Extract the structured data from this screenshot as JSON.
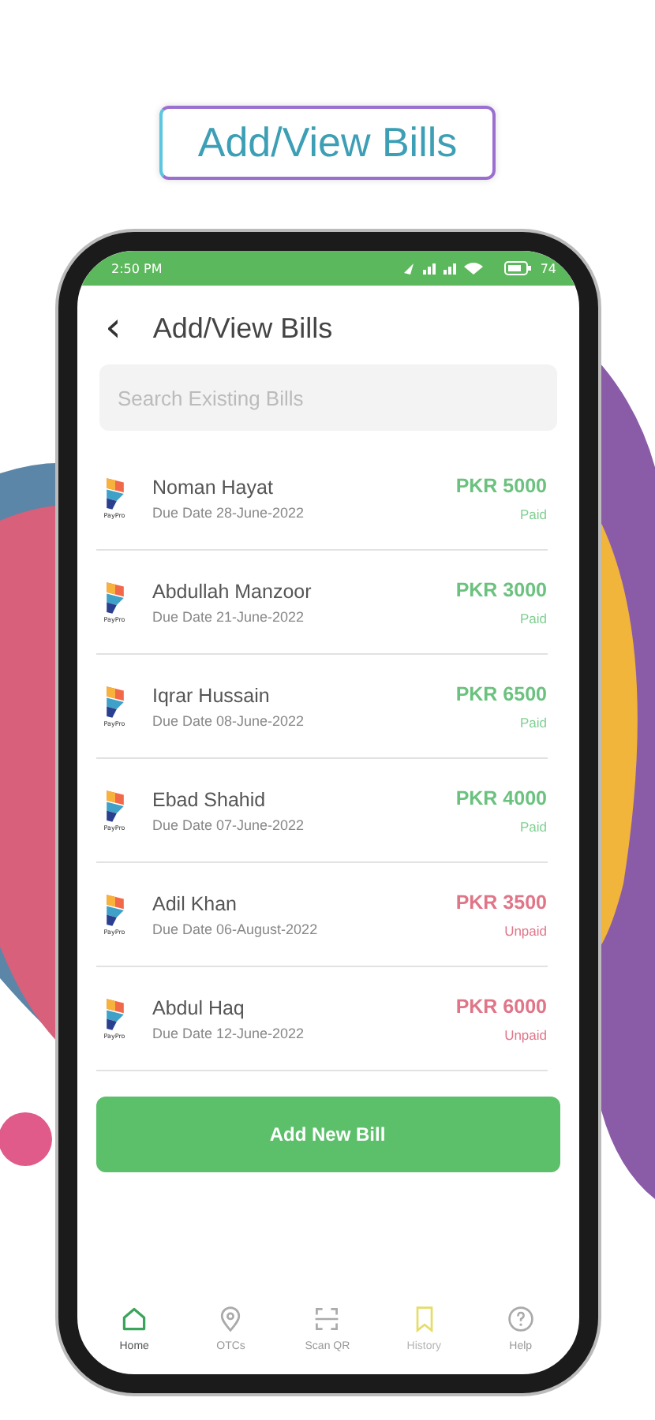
{
  "banner": {
    "title": "Add/View Bills"
  },
  "status_bar": {
    "time": "2:50 PM",
    "battery": "74"
  },
  "header": {
    "back": "‹",
    "title": "Add/View Bills"
  },
  "search": {
    "placeholder": "Search Existing Bills"
  },
  "bills": [
    {
      "logo_caption": "PayPro",
      "name": "Noman Hayat",
      "due": "Due Date 28-June-2022",
      "amount": "PKR 5000",
      "kind": "paid",
      "status_text": "Paid"
    },
    {
      "logo_caption": "PayPro",
      "name": "Abdullah Manzoor",
      "due": "Due Date 21-June-2022",
      "amount": "PKR 3000",
      "kind": "paid",
      "status_text": "Paid"
    },
    {
      "logo_caption": "PayPro",
      "name": "Iqrar Hussain",
      "due": "Due Date 08-June-2022",
      "amount": "PKR 6500",
      "kind": "paid",
      "status_text": "Paid"
    },
    {
      "logo_caption": "PayPro",
      "name": "Ebad Shahid",
      "due": "Due Date 07-June-2022",
      "amount": "PKR 4000",
      "kind": "paid",
      "status_text": "Paid"
    },
    {
      "logo_caption": "PayPro",
      "name": "Adil Khan",
      "due": "Due Date 06-August-2022",
      "amount": "PKR 3500",
      "kind": "unpaid",
      "status_text": "Unpaid"
    },
    {
      "logo_caption": "PayPro",
      "name": "Abdul Haq",
      "due": "Due Date 12-June-2022",
      "amount": "PKR 6000",
      "kind": "unpaid",
      "status_text": "Unpaid"
    }
  ],
  "add_button": "Add New Bill",
  "nav": [
    {
      "kind": "home",
      "label": "Home",
      "selected": true,
      "disabled": false
    },
    {
      "kind": "pin",
      "label": "OTCs",
      "selected": false,
      "disabled": false
    },
    {
      "kind": "scan",
      "label": "Scan QR",
      "selected": false,
      "disabled": false
    },
    {
      "kind": "bookmark",
      "label": "History",
      "selected": false,
      "disabled": true
    },
    {
      "kind": "help",
      "label": "Help",
      "selected": false,
      "disabled": false
    }
  ]
}
